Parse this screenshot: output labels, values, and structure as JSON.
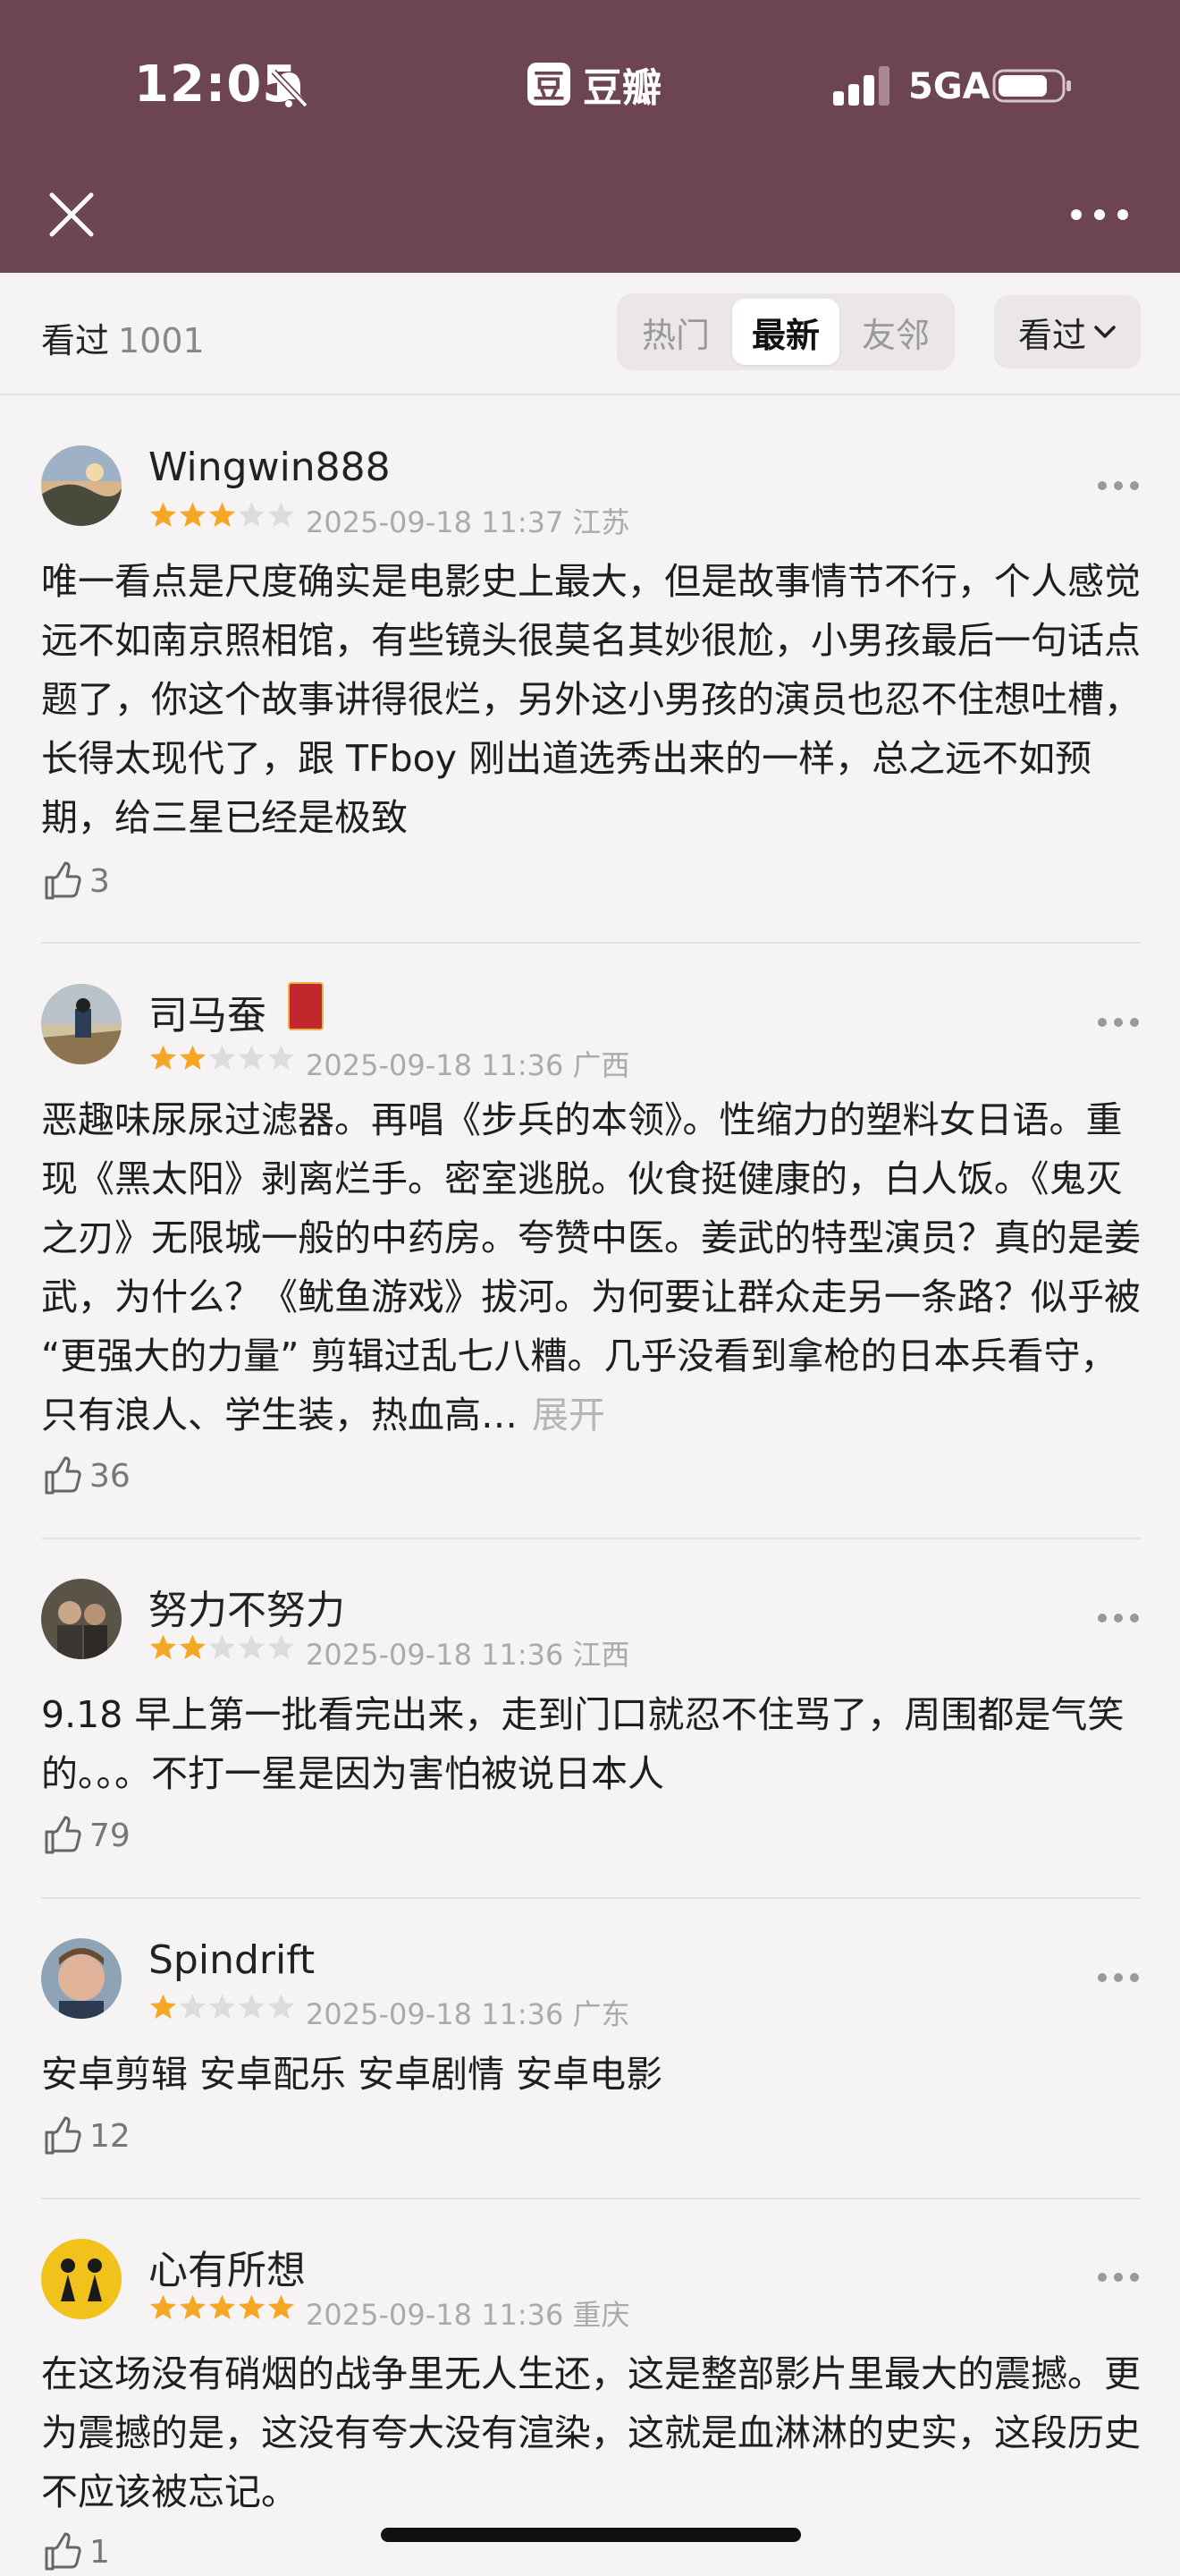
{
  "status_bar": {
    "time": "12:05",
    "app_name": "豆瓣",
    "network": "5GA"
  },
  "toolbar": {
    "close_icon": "close-icon",
    "more_icon": "more-icon"
  },
  "filter": {
    "seen_label": "看过",
    "seen_count": "1001",
    "tabs": [
      {
        "label": "热门",
        "active": false
      },
      {
        "label": "最新",
        "active": true
      },
      {
        "label": "友邻",
        "active": false
      }
    ],
    "sort_label": "看过"
  },
  "reviews": [
    {
      "user": "Wingwin888",
      "rating": 3,
      "meta": "2025-09-18 11:37 江苏",
      "content": "唯一看点是尺度确实是电影史上最大，但是故事情节不行，个人感觉远不如南京照相馆，有些镜头很莫名其妙很尬，小男孩最后一句话点题了，你这个故事讲得很烂，另外这小男孩的演员也忍不住想吐槽，长得太现代了，跟 TFboy 刚出道选秀出来的一样，总之远不如预期，给三星已经是极致",
      "likes": "3"
    },
    {
      "user": "司马蚕",
      "rating": 2,
      "meta": "2025-09-18 11:36 广西",
      "content": "恶趣味尿尿过滤器。再唱《步兵的本领》。性缩力的塑料女日语。重现《黑太阳》剥离烂手。密室逃脱。伙食挺健康的，白人饭。《鬼灭之刃》无限城一般的中药房。夸赞中医。姜武的特型演员？真的是姜武，为什么？《鱿鱼游戏》拔河。为何要让群众走另一条路？似乎被 “更强大的力量” 剪辑过乱七八糟。几乎没看到拿枪的日本兵看守，只有浪人、学生装，热血高…",
      "expand": "展开",
      "likes": "36"
    },
    {
      "user": "努力不努力",
      "rating": 2,
      "meta": "2025-09-18 11:36 江西",
      "content": "9.18 早上第一批看完出来，走到门口就忍不住骂了，周围都是气笑的。。。不打一星是因为害怕被说日本人",
      "likes": "79"
    },
    {
      "user": "Spindrift",
      "rating": 1,
      "meta": "2025-09-18 11:36 广东",
      "content": "安卓剪辑 安卓配乐 安卓剧情 安卓电影",
      "likes": "12"
    },
    {
      "user": "心有所想",
      "rating": 5,
      "meta": "2025-09-18 11:36 重庆",
      "content": "在这场没有硝烟的战争里无人生还，这是整部影片里最大的震撼。更为震撼的是，这没有夸大没有渲染，这就是血淋淋的史实，这段历史不应该被忘记。",
      "likes": "1"
    }
  ],
  "colors": {
    "header": "#6d4550",
    "star_on": "#f5a623",
    "star_off": "#dcdcdc"
  }
}
